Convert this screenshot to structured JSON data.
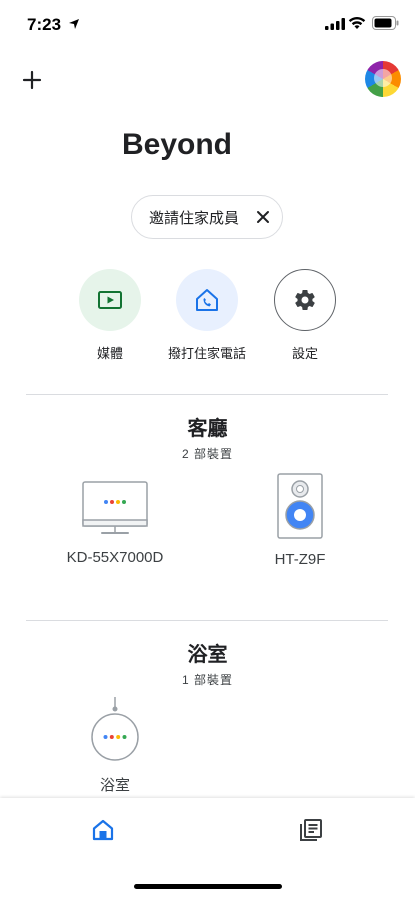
{
  "status_bar": {
    "time": "7:23"
  },
  "home": {
    "title": "Beyond"
  },
  "invite_chip": {
    "label": "邀請住家成員"
  },
  "actions": [
    {
      "label": "媒體",
      "icon": "media-play-icon"
    },
    {
      "label": "撥打住家電話",
      "icon": "home-call-icon"
    },
    {
      "label": "設定",
      "icon": "gear-icon"
    }
  ],
  "rooms": [
    {
      "name": "客廳",
      "count": "2 部裝置",
      "devices": [
        {
          "label": "KD-55X7000D",
          "icon": "tv-icon"
        },
        {
          "label": "HT-Z9F",
          "icon": "speaker-icon"
        }
      ]
    },
    {
      "name": "浴室",
      "count": "1 部裝置",
      "devices": [
        {
          "label": "浴室",
          "icon": "nest-mini-icon"
        }
      ]
    }
  ],
  "bottom_nav": {
    "items": [
      {
        "icon": "home-icon",
        "active": true
      },
      {
        "icon": "feed-icon",
        "active": false
      }
    ]
  },
  "colors": {
    "accent_blue": "#1a73e8",
    "media_bg": "#e6f4ea",
    "media_green": "#137333",
    "call_bg": "#e8f0fe",
    "divider": "#dadce0",
    "dot_blue": "#4285f4",
    "dot_red": "#ea4335",
    "dot_yellow": "#fbbc04",
    "dot_green": "#34a853"
  }
}
